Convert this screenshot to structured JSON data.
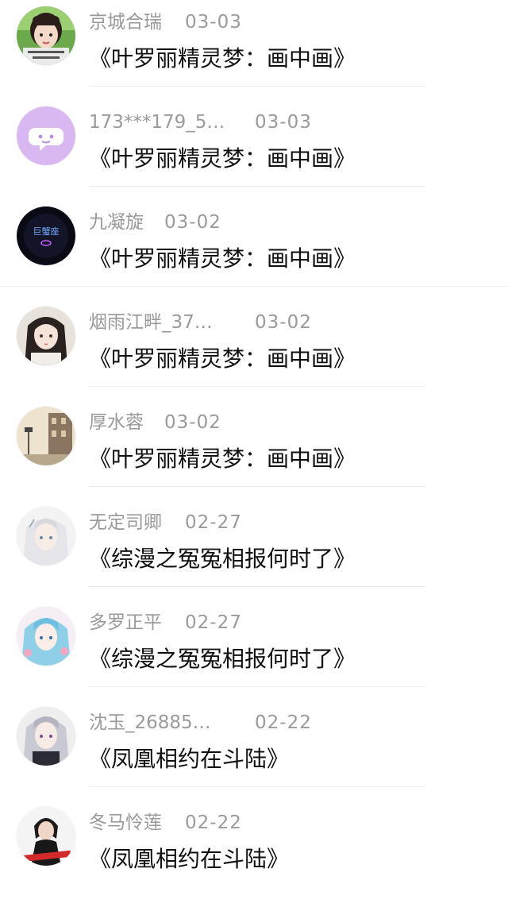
{
  "items": [
    {
      "user": "京城合瑞",
      "date": "03-03",
      "book": "《叶罗丽精灵梦：画中画》",
      "avatar": "girl-photo-avatar"
    },
    {
      "user": "173***179_5…",
      "date": "03-03",
      "book": "《叶罗丽精灵梦：画中画》",
      "avatar": "default-chat-avatar"
    },
    {
      "user": "九凝旋",
      "date": "03-02",
      "book": "《叶罗丽精灵梦：画中画》",
      "avatar": "dark-logo-avatar",
      "avatar_text": "巨蟹座"
    },
    {
      "user": "烟雨江畔_37…",
      "date": "03-02",
      "book": "《叶罗丽精灵梦：画中画》",
      "avatar": "anime-girl-avatar"
    },
    {
      "user": "厚水蓉",
      "date": "03-02",
      "book": "《叶罗丽精灵梦：画中画》",
      "avatar": "street-photo-avatar"
    },
    {
      "user": "无定司卿",
      "date": "02-27",
      "book": "《综漫之冤冤相报何时了》",
      "avatar": "anime-white-hair-avatar"
    },
    {
      "user": "多罗正平",
      "date": "02-27",
      "book": "《综漫之冤冤相报何时了》",
      "avatar": "anime-blue-hair-avatar"
    },
    {
      "user": "沈玉_26885…",
      "date": "02-22",
      "book": "《凤凰相约在斗陆》",
      "avatar": "anime-silver-hair-avatar"
    },
    {
      "user": "冬马怜莲",
      "date": "02-22",
      "book": "《凤凰相约在斗陆》",
      "avatar": "woman-photo-avatar"
    }
  ],
  "colors": {
    "meta_text": "#9a9a9a",
    "book_text": "#111111",
    "divider": "#ededed",
    "default_avatar_bg": "#d9b8f2"
  }
}
